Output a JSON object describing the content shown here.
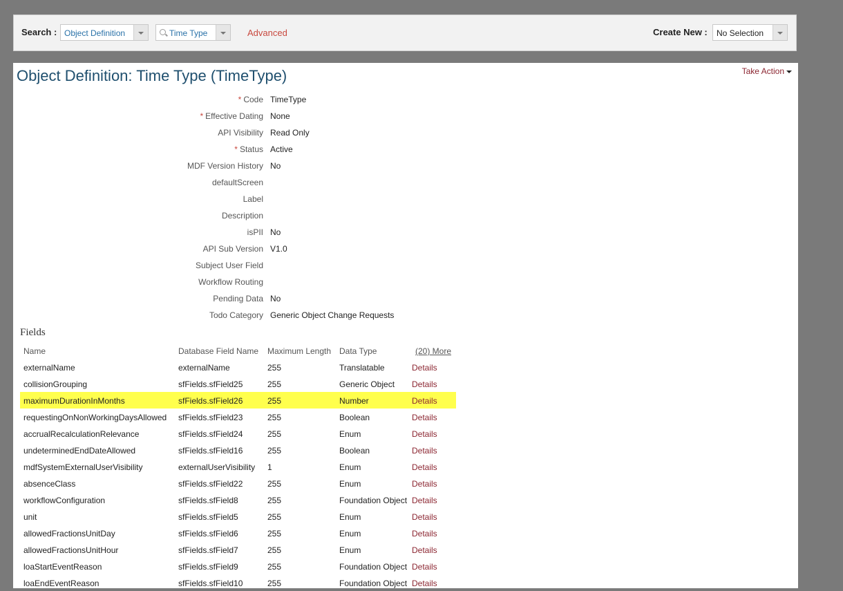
{
  "search": {
    "label": "Search :",
    "type_value": "Object Definition",
    "object_value": "Time Type",
    "advanced": "Advanced",
    "create_new_label": "Create New :",
    "create_new_value": "No Selection"
  },
  "page": {
    "title": "Object Definition: Time Type (TimeType)",
    "take_action": "Take Action"
  },
  "properties": [
    {
      "label": "Code",
      "required": true,
      "value": "TimeType"
    },
    {
      "label": "Effective Dating",
      "required": true,
      "value": "None"
    },
    {
      "label": "API Visibility",
      "required": false,
      "value": "Read Only"
    },
    {
      "label": "Status",
      "required": true,
      "value": "Active"
    },
    {
      "label": "MDF Version History",
      "required": false,
      "value": "No"
    },
    {
      "label": "defaultScreen",
      "required": false,
      "value": ""
    },
    {
      "label": "Label",
      "required": false,
      "value": ""
    },
    {
      "label": "Description",
      "required": false,
      "value": ""
    },
    {
      "label": "isPII",
      "required": false,
      "value": "No"
    },
    {
      "label": "API Sub Version",
      "required": false,
      "value": "V1.0"
    },
    {
      "label": "Subject User Field",
      "required": false,
      "value": ""
    },
    {
      "label": "Workflow Routing",
      "required": false,
      "value": ""
    },
    {
      "label": "Pending Data",
      "required": false,
      "value": "No"
    },
    {
      "label": "Todo Category",
      "required": false,
      "value": "Generic Object Change Requests"
    }
  ],
  "fields": {
    "title": "Fields",
    "columns": {
      "name": "Name",
      "db": "Database Field Name",
      "maxlen": "Maximum Length",
      "type": "Data Type",
      "more": "(20) More"
    },
    "details_label": "Details",
    "rows": [
      {
        "name": "externalName",
        "db": "externalName",
        "maxlen": "255",
        "type": "Translatable",
        "highlight": false
      },
      {
        "name": "collisionGrouping",
        "db": "sfFields.sfField25",
        "maxlen": "255",
        "type": "Generic Object",
        "highlight": false
      },
      {
        "name": "maximumDurationInMonths",
        "db": "sfFields.sfField26",
        "maxlen": "255",
        "type": "Number",
        "highlight": true
      },
      {
        "name": "requestingOnNonWorkingDaysAllowed",
        "db": "sfFields.sfField23",
        "maxlen": "255",
        "type": "Boolean",
        "highlight": false
      },
      {
        "name": "accrualRecalculationRelevance",
        "db": "sfFields.sfField24",
        "maxlen": "255",
        "type": "Enum",
        "highlight": false
      },
      {
        "name": "undeterminedEndDateAllowed",
        "db": "sfFields.sfField16",
        "maxlen": "255",
        "type": "Boolean",
        "highlight": false
      },
      {
        "name": "mdfSystemExternalUserVisibility",
        "db": "externalUserVisibility",
        "maxlen": "1",
        "type": "Enum",
        "highlight": false
      },
      {
        "name": "absenceClass",
        "db": "sfFields.sfField22",
        "maxlen": "255",
        "type": "Enum",
        "highlight": false
      },
      {
        "name": "workflowConfiguration",
        "db": "sfFields.sfField8",
        "maxlen": "255",
        "type": "Foundation Object",
        "highlight": false
      },
      {
        "name": "unit",
        "db": "sfFields.sfField5",
        "maxlen": "255",
        "type": "Enum",
        "highlight": false
      },
      {
        "name": "allowedFractionsUnitDay",
        "db": "sfFields.sfField6",
        "maxlen": "255",
        "type": "Enum",
        "highlight": false
      },
      {
        "name": "allowedFractionsUnitHour",
        "db": "sfFields.sfField7",
        "maxlen": "255",
        "type": "Enum",
        "highlight": false
      },
      {
        "name": "loaStartEventReason",
        "db": "sfFields.sfField9",
        "maxlen": "255",
        "type": "Foundation Object",
        "highlight": false
      },
      {
        "name": "loaEndEventReason",
        "db": "sfFields.sfField10",
        "maxlen": "255",
        "type": "Foundation Object",
        "highlight": false
      }
    ]
  }
}
